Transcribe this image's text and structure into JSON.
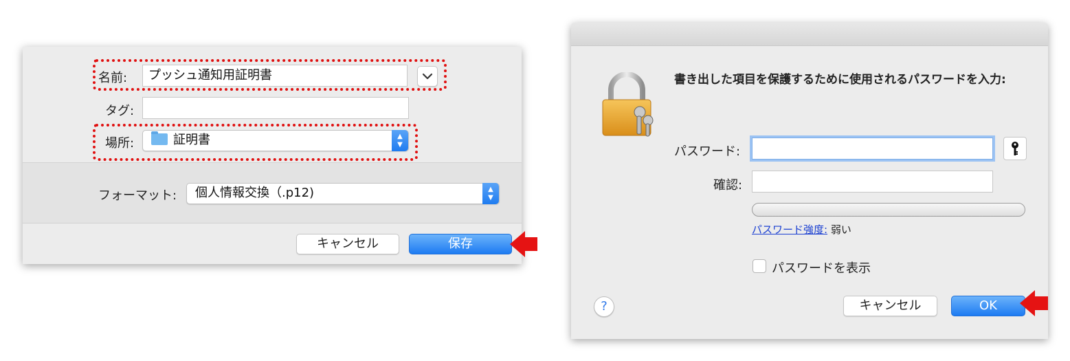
{
  "save_dialog": {
    "name_label": "名前:",
    "name_value": "プッシュ通知用証明書",
    "tag_label": "タグ:",
    "tag_value": "",
    "location_label": "場所:",
    "location_value": "証明書",
    "format_label": "フォーマット:",
    "format_value": "個人情報交換（.p12)",
    "cancel_label": "キャンセル",
    "save_label": "保存"
  },
  "password_dialog": {
    "message": "書き出した項目を保護するために使用されるパスワードを入力:",
    "password_label": "パスワード:",
    "password_value": "",
    "verify_label": "確認:",
    "verify_value": "",
    "strength_link": "パスワード強度:",
    "strength_value": "弱い",
    "show_password_label": "パスワードを表示",
    "show_password_checked": false,
    "help_label": "?",
    "cancel_label": "キャンセル",
    "ok_label": "OK"
  },
  "icons": {
    "lock": "padlock-with-keys-icon",
    "key": "key-icon",
    "folder": "folder-icon",
    "chevron": "chevron-down-icon",
    "stepper": "up-down-stepper-icon",
    "help": "help-icon",
    "annotation_arrow": "red-arrow-icon"
  },
  "colors": {
    "annotation_red": "#e51313",
    "primary_blue": "#1d7bf2",
    "dialog_bg": "#ececec",
    "link_blue": "#1a3fd1"
  }
}
